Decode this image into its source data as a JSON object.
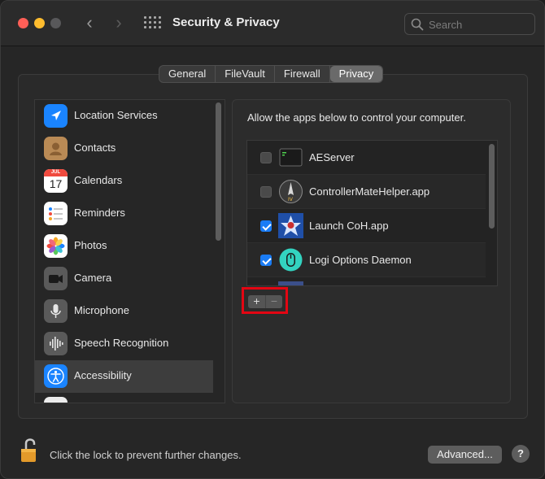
{
  "window": {
    "title": "Security & Privacy"
  },
  "search": {
    "placeholder": "Search"
  },
  "tabs": [
    {
      "label": "General"
    },
    {
      "label": "FileVault"
    },
    {
      "label": "Firewall"
    },
    {
      "label": "Privacy",
      "active": true
    }
  ],
  "sidebar": {
    "selected": "Accessibility",
    "items": [
      {
        "label": "Location Services",
        "icon": "location-arrow-icon",
        "color": "#1a84ff"
      },
      {
        "label": "Contacts",
        "icon": "contacts-book-icon",
        "color": "#b98a55"
      },
      {
        "label": "Calendars",
        "icon": "calendar-icon",
        "month": "JUL",
        "day": "17"
      },
      {
        "label": "Reminders",
        "icon": "reminders-list-icon"
      },
      {
        "label": "Photos",
        "icon": "photos-flower-icon"
      },
      {
        "label": "Camera",
        "icon": "camera-icon"
      },
      {
        "label": "Microphone",
        "icon": "microphone-icon"
      },
      {
        "label": "Speech Recognition",
        "icon": "waveform-icon"
      },
      {
        "label": "Accessibility",
        "icon": "accessibility-icon",
        "color": "#1a84ff"
      }
    ]
  },
  "main": {
    "description": "Allow the apps below to control your computer.",
    "apps": [
      {
        "label": "AEServer",
        "checked": false,
        "icon": "terminal-app-icon"
      },
      {
        "label": "ControllerMateHelper.app",
        "checked": false,
        "icon": "controllermate-app-icon"
      },
      {
        "label": "Launch CoH.app",
        "checked": true,
        "icon": "launch-coh-app-icon"
      },
      {
        "label": "Logi Options Daemon",
        "checked": true,
        "icon": "logi-mouse-app-icon"
      }
    ],
    "add_label": "+",
    "remove_label": "−"
  },
  "footer": {
    "lock_text": "Click the lock to prevent further changes.",
    "advanced_label": "Advanced...",
    "help_label": "?"
  },
  "colors": {
    "accent": "#1a7cf5",
    "highlight_box": "#e30613"
  }
}
